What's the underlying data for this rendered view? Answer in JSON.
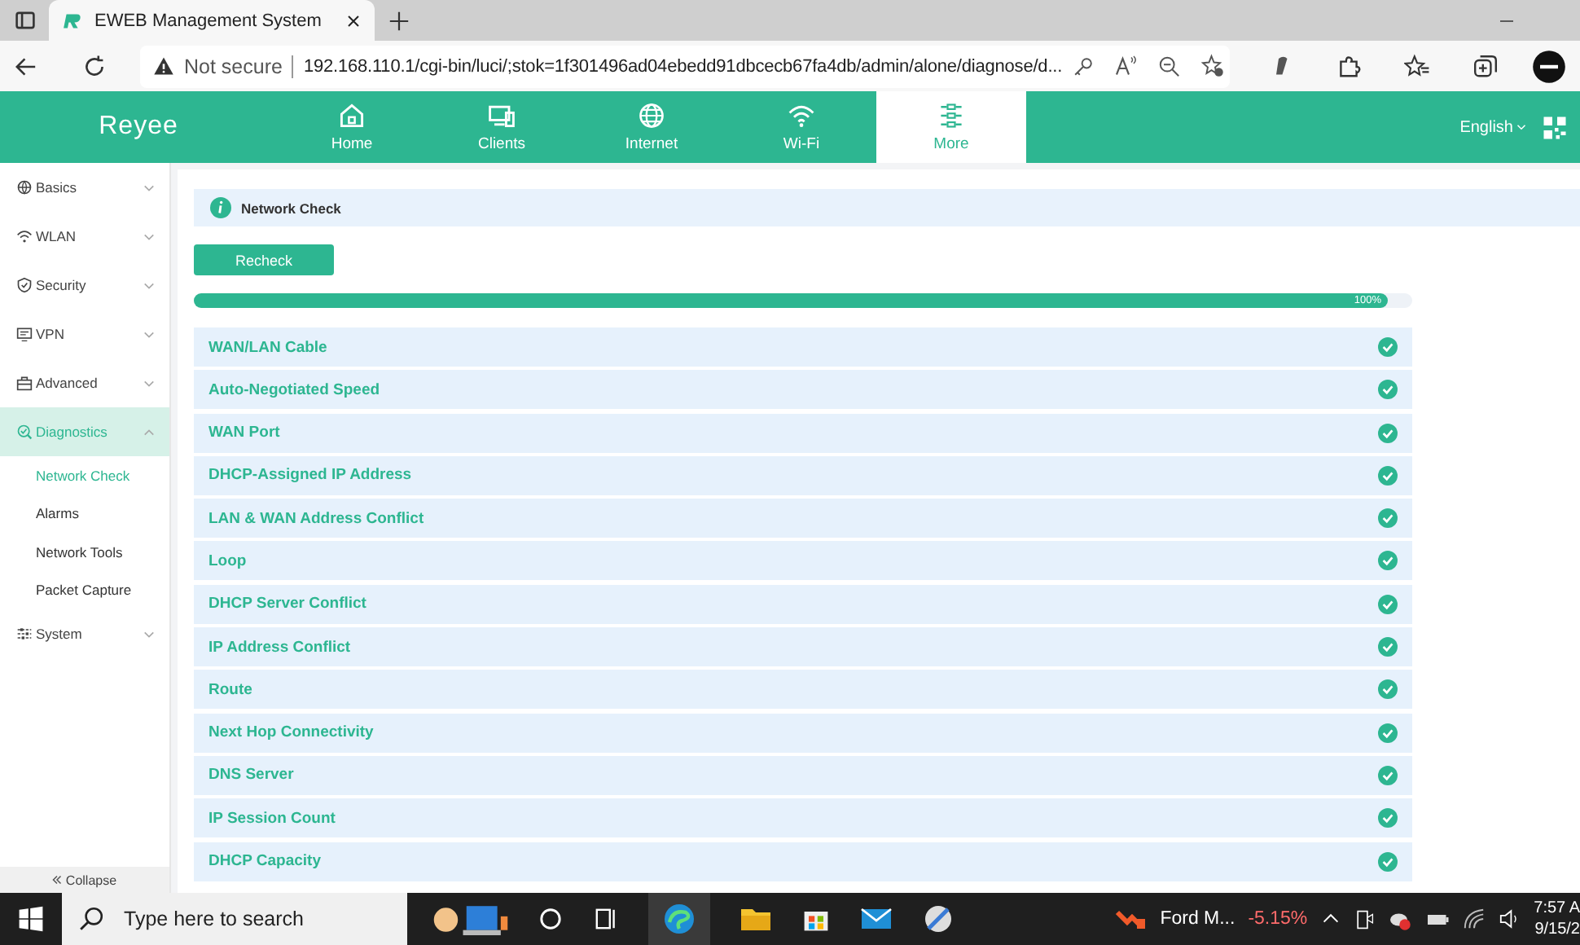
{
  "browser": {
    "tab_title": "EWEB Management System",
    "security": "Not secure",
    "url": "192.168.110.1/cgi-bin/luci/;stok=1f301496ad04ebedd91dbcecb67fa4db/admin/alone/diagnose/d..."
  },
  "header": {
    "logo": "Reyee",
    "language": "English",
    "nav": [
      {
        "label": "Home",
        "selected": false
      },
      {
        "label": "Clients",
        "selected": false
      },
      {
        "label": "Internet",
        "selected": false
      },
      {
        "label": "Wi-Fi",
        "selected": false
      },
      {
        "label": "More",
        "selected": true
      }
    ]
  },
  "sidebar": {
    "items": [
      {
        "label": "Basics",
        "selected": false,
        "expanded": false
      },
      {
        "label": "WLAN",
        "selected": false,
        "expanded": false
      },
      {
        "label": "Security",
        "selected": false,
        "expanded": false
      },
      {
        "label": "VPN",
        "selected": false,
        "expanded": false
      },
      {
        "label": "Advanced",
        "selected": false,
        "expanded": false
      },
      {
        "label": "Diagnostics",
        "selected": true,
        "expanded": true,
        "children": [
          {
            "label": "Network Check",
            "selected": true
          },
          {
            "label": "Alarms",
            "selected": false
          },
          {
            "label": "Network Tools",
            "selected": false
          },
          {
            "label": "Packet Capture",
            "selected": false
          }
        ]
      },
      {
        "label": "System",
        "selected": false,
        "expanded": false
      }
    ],
    "collapse": "Collapse"
  },
  "content": {
    "title": "Network Check",
    "button": "Recheck",
    "progress": {
      "level": 0.98,
      "reading": "100%"
    },
    "checks": [
      {
        "name": "WAN/LAN Cable",
        "passed": true
      },
      {
        "name": "Auto-Negotiated Speed",
        "passed": true
      },
      {
        "name": "WAN Port",
        "passed": true
      },
      {
        "name": "DHCP-Assigned IP Address",
        "passed": true
      },
      {
        "name": "LAN & WAN Address Conflict",
        "passed": true
      },
      {
        "name": "Loop",
        "passed": true
      },
      {
        "name": "DHCP Server Conflict",
        "passed": true
      },
      {
        "name": "IP Address Conflict",
        "passed": true
      },
      {
        "name": "Route",
        "passed": true
      },
      {
        "name": "Next Hop Connectivity",
        "passed": true
      },
      {
        "name": "DNS Server",
        "passed": true
      },
      {
        "name": "IP Session Count",
        "passed": true
      },
      {
        "name": "DHCP Capacity",
        "passed": true
      }
    ]
  },
  "taskbar": {
    "search_placeholder": "Type here to search",
    "stock_name": "Ford M...",
    "stock_change": "-5.15%",
    "time": "7:57 A",
    "date": "9/15/2"
  }
}
